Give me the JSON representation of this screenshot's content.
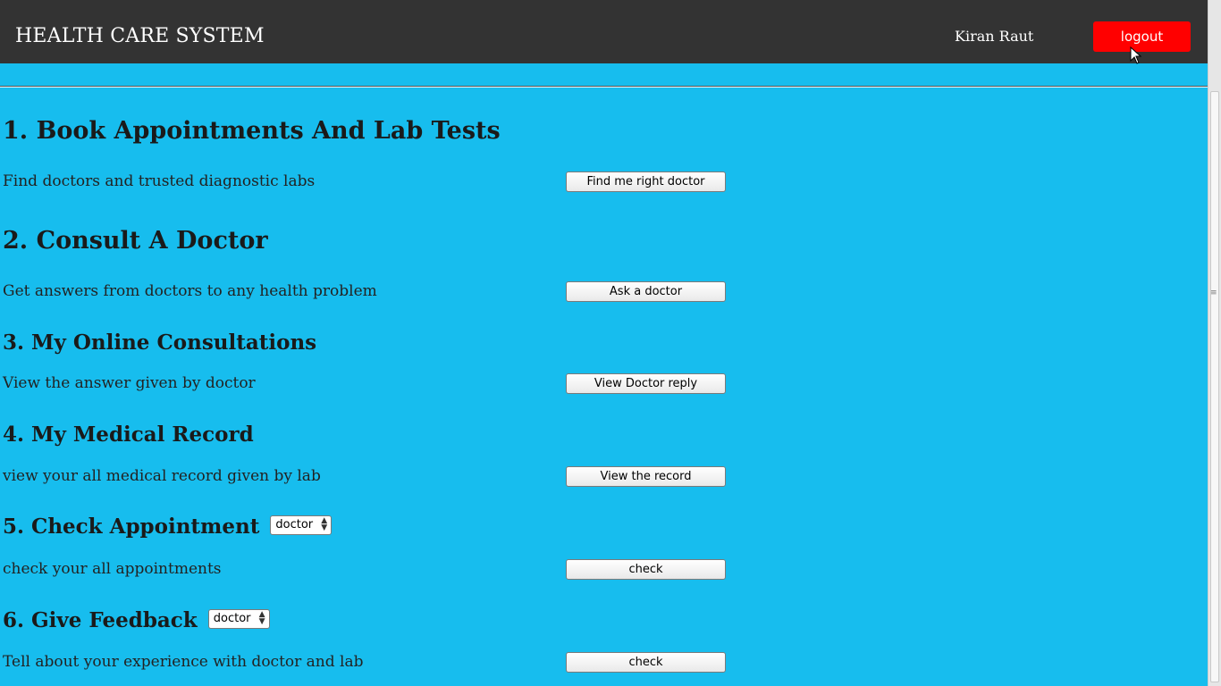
{
  "header": {
    "brand": "HEALTH CARE SYSTEM",
    "user_name": "Kiran Raut",
    "logout_label": "logout"
  },
  "sections": [
    {
      "title": "1. Book Appointments And Lab Tests",
      "description": "Find doctors and trusted diagnostic labs",
      "button": "Find me right doctor"
    },
    {
      "title": "2. Consult A Doctor",
      "description": "Get answers from doctors to any health problem",
      "button": "Ask a doctor"
    },
    {
      "title": "3. My Online Consultations",
      "description": "View the answer given by doctor",
      "button": "View Doctor reply"
    },
    {
      "title": "4. My Medical Record",
      "description": "view your all medical record given by lab",
      "button": "View the record"
    },
    {
      "title": "5. Check Appointment",
      "select_value": "doctor",
      "description": "check your all appointments",
      "button": "check"
    },
    {
      "title": "6. Give Feedback",
      "select_value": "doctor",
      "description": "Tell about your experience with doctor and lab",
      "button": "check"
    }
  ],
  "colors": {
    "background": "#17bdee",
    "header": "#333333",
    "logout": "#ff0000"
  }
}
